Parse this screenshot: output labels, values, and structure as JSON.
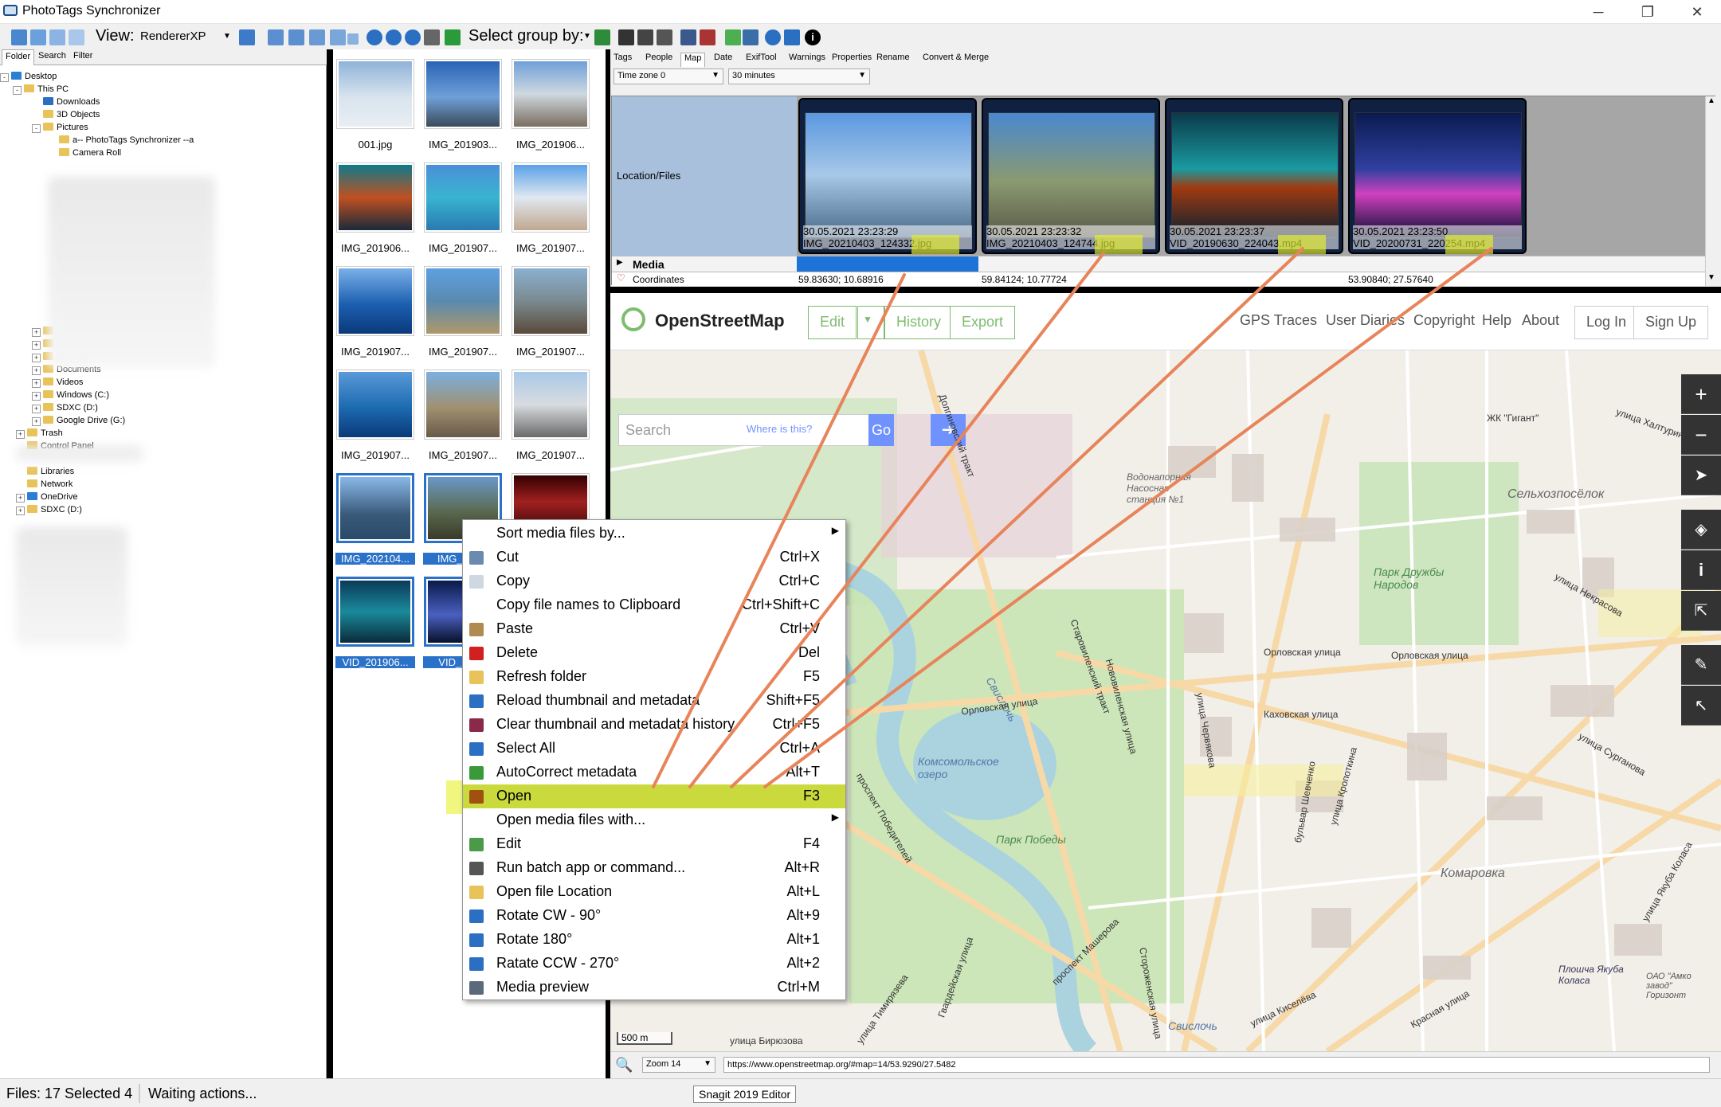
{
  "window": {
    "title": "PhotoTags Synchronizer"
  },
  "toolbar": {
    "view_label": "View:",
    "view_value": "RendererXP",
    "select_group_label": "Select group by:"
  },
  "left_tabs": [
    "Folder",
    "Search",
    "Filter"
  ],
  "tree": [
    "Desktop",
    "This PC",
    "Downloads",
    "3D Objects",
    "Pictures",
    "a-- PhotoTags Synchronizer --a",
    "Camera Roll",
    "Users",
    "Music",
    "Desktop",
    "Documents",
    "Videos",
    "Windows (C:)",
    "SDXC (D:)",
    "Google Drive (G:)",
    "Trash",
    "Control Panel",
    "Libraries",
    "Network",
    "OneDrive",
    "SDXC (D:)"
  ],
  "thumbs": [
    "001.jpg",
    "IMG_201903...",
    "IMG_201906...",
    "IMG_201906...",
    "IMG_201907...",
    "IMG_201907...",
    "IMG_201907...",
    "IMG_201907...",
    "IMG_201907...",
    "IMG_201907...",
    "IMG_201907...",
    "IMG_201907...",
    "IMG_202104...",
    "IMG_202...",
    "",
    "VID_201906...",
    "VID_202..."
  ],
  "right_tabs": [
    "Tags",
    "People",
    "Map",
    "Date",
    "ExifTool",
    "Warnings",
    "Properties",
    "Rename",
    "Convert & Merge"
  ],
  "timezone": {
    "zone": "Time zone 0",
    "interval": "30 minutes"
  },
  "grid": {
    "location_label": "Location/Files",
    "media_label": "Media",
    "coordinates_label": "Coordinates",
    "coords": [
      "59.83630; 10.68916",
      "59.84124; 10.77724",
      "53.90840; 27.57640"
    ],
    "cells": [
      {
        "date": "30.05.2021 23:23:29",
        "file": "IMG_20210403_124332.jpg"
      },
      {
        "date": "30.05.2021 23:23:32",
        "file": "IMG_20210403_124744.jpg"
      },
      {
        "date": "30.05.2021 23:23:37",
        "file": "VID_20190630_224043.mp4"
      },
      {
        "date": "30.05.2021 23:23:50",
        "file": "VID_20200731_220254.mp4"
      }
    ]
  },
  "osm": {
    "brand": "OpenStreetMap",
    "edit": "Edit",
    "history": "History",
    "export": "Export",
    "links": [
      "GPS Traces",
      "User Diaries",
      "Copyright",
      "Help",
      "About"
    ],
    "login": "Log In",
    "signup": "Sign Up",
    "search_placeholder": "Search",
    "where": "Where is this?",
    "go": "Go",
    "scale": "500 m",
    "zoom": "Zoom 14",
    "url": "https://www.openstreetmap.org/#map=14/53.9290/27.5482",
    "labels": {
      "selkhoz": "Сельхозпосёлок",
      "park_druzhby": "Парк Дружбы Народов",
      "komsomol": "Комсомольское озеро",
      "park_pobedy": "Парк Победы",
      "komarovka": "Комаровка",
      "vodonapor": "Водонапорная Насосная станция №1",
      "svisloch1": "Свислочь",
      "svisloch2": "Свислочь",
      "orlovskaya1": "Орловская улица",
      "orlovskaya2": "Орловская улица",
      "orlovskaya3": "Орловская улица",
      "kakhovskaya": "Каховская улица",
      "khalturina": "улица Халтурина",
      "nekrasova": "улица Некрасова",
      "surganova": "улица Сурганова",
      "kolasa": "улица Якуба Коласа",
      "ploshcha": "Плошча Якуба Коласа",
      "pobediteley": "проспект Победителей",
      "masherova": "проспект Машерова",
      "giganta": "ЖК \"Гигант\"",
      "dolgin": "Долгиновский тракт",
      "starovilen": "Старовиленский тракт",
      "shevchenko": "бульвар Шевченко",
      "kropotkina": "улица Кропоткина",
      "birjuzova": "улица Бирюзова",
      "kiseleva": "улица Киселёва",
      "krasnaya": "Красная улица",
      "storozh": "Стороженская улица",
      "chervyakova": "улица Червякова",
      "novovilenskaya": "Нововиленская улица",
      "gvardeyskaya": "Гвардейская улица",
      "tsimiryazeva": "улица Тимирязева",
      "amko": "ОАО \"Амко завод\" Горизонт"
    }
  },
  "context_menu": [
    {
      "label": "Sort media files by...",
      "shortcut": "",
      "submenu": true,
      "icon": ""
    },
    {
      "label": "Cut",
      "shortcut": "Ctrl+X",
      "icon": "scissors-icon"
    },
    {
      "label": "Copy",
      "shortcut": "Ctrl+C",
      "icon": "copy-icon"
    },
    {
      "label": "Copy file names to Clipboard",
      "shortcut": "Ctrl+Shift+C",
      "icon": ""
    },
    {
      "label": "Paste",
      "shortcut": "Ctrl+V",
      "icon": "paste-icon"
    },
    {
      "label": "Delete",
      "shortcut": "Del",
      "icon": "delete-icon"
    },
    {
      "label": "Refresh folder",
      "shortcut": "F5",
      "icon": "refresh-folder-icon"
    },
    {
      "label": "Reload thumbnail and metadata",
      "shortcut": "Shift+F5",
      "icon": "reload-icon"
    },
    {
      "label": "Clear thumbnail and metadata history",
      "shortcut": "Ctrl+F5",
      "icon": "clear-icon"
    },
    {
      "label": "Select All",
      "shortcut": "Ctrl+A",
      "icon": "select-all-icon"
    },
    {
      "label": "AutoCorrect metadata",
      "shortcut": "Alt+T",
      "icon": "autocorrect-icon"
    },
    {
      "label": "Open",
      "shortcut": "F3",
      "icon": "open-icon",
      "highlight": true
    },
    {
      "label": "Open media files with...",
      "shortcut": "",
      "submenu": true,
      "icon": ""
    },
    {
      "label": "Edit",
      "shortcut": "F4",
      "icon": "edit-icon"
    },
    {
      "label": "Run batch app or command...",
      "shortcut": "Alt+R",
      "icon": "batch-icon"
    },
    {
      "label": "Open file Location",
      "shortcut": "Alt+L",
      "icon": "folder-icon"
    },
    {
      "label": "Rotate CW - 90°",
      "shortcut": "Alt+9",
      "icon": "rotate-cw-icon"
    },
    {
      "label": "Rotate 180°",
      "shortcut": "Alt+1",
      "icon": "rotate-180-icon"
    },
    {
      "label": "Ratate CCW - 270°",
      "shortcut": "Alt+2",
      "icon": "rotate-ccw-icon"
    },
    {
      "label": "Media preview",
      "shortcut": "Ctrl+M",
      "icon": "preview-icon"
    }
  ],
  "status": {
    "files": "Files: 17 Selected 4",
    "waiting": "Waiting actions...",
    "tooltip": "Snagit 2019 Editor"
  },
  "colors": {
    "selection": "#2a71c9",
    "highlight": "#c4d628",
    "osm_green": "#7ebc6f",
    "arrow": "#e8845a"
  }
}
